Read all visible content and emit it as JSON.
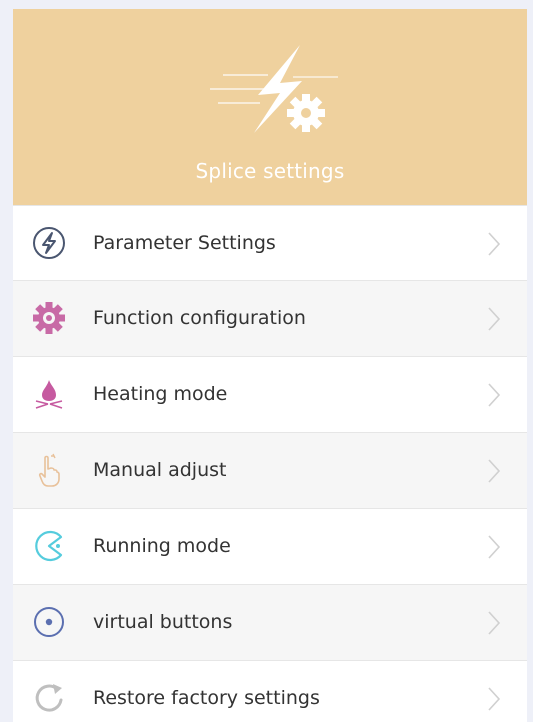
{
  "header": {
    "title": "Splice settings",
    "icon": "lightning-gear-icon",
    "background": "#efd19e"
  },
  "menu": {
    "items": [
      {
        "label": "Parameter Settings",
        "icon": "lightning-circle-icon",
        "color": "#4a5670"
      },
      {
        "label": "Function configuration",
        "icon": "gear-icon",
        "color": "#c86aa6"
      },
      {
        "label": "Heating mode",
        "icon": "flame-icon",
        "color": "#c65aa0"
      },
      {
        "label": "Manual adjust",
        "icon": "hand-pointer-icon",
        "color": "#e8c19a"
      },
      {
        "label": "Running mode",
        "icon": "pacman-icon",
        "color": "#55ccdd"
      },
      {
        "label": "virtual buttons",
        "icon": "radio-button-icon",
        "color": "#5b6fb0"
      },
      {
        "label": "Restore factory settings",
        "icon": "refresh-icon",
        "color": "#bfbfbf"
      }
    ]
  }
}
